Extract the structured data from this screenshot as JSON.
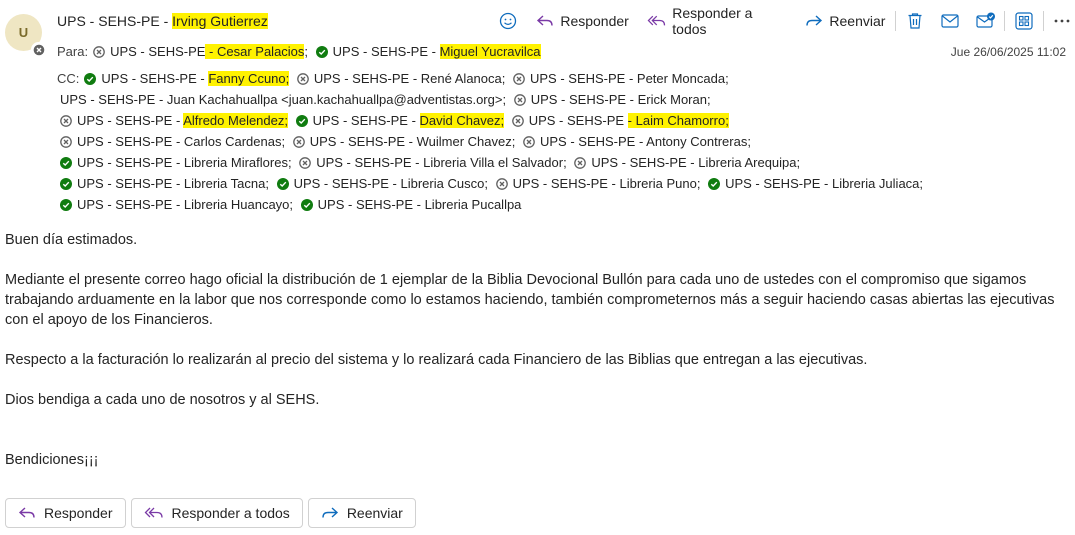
{
  "sender": {
    "avatar_initial": "U",
    "prefix": "UPS - SEHS-PE - ",
    "name": "Irving Gutierrez"
  },
  "toolbar": {
    "reply": "Responder",
    "reply_all": "Responder a todos",
    "forward": "Reenviar"
  },
  "date": "Jue 26/06/2025 11:02",
  "to_label": "Para:",
  "cc_label": "CC:",
  "to": [
    {
      "status": "blocked",
      "pre": "UPS - SEHS-PE",
      "hl": " - Cesar Palacios",
      "post": "",
      "sep": ";"
    },
    {
      "status": "ok",
      "pre": "UPS - SEHS-PE - ",
      "hl": "Miguel Yucravilca  ",
      "post": "",
      "sep": ""
    }
  ],
  "cc_lines": [
    [
      {
        "status": "ok",
        "pre": "UPS - SEHS-PE - ",
        "hl": "Fanny Ccuno;",
        "post": "",
        "sep": ""
      },
      {
        "status": "blocked",
        "pre": "UPS - SEHS-PE - René Alanoca",
        "hl": "",
        "post": "",
        "sep": ";"
      },
      {
        "status": "blocked",
        "pre": "UPS - SEHS-PE - Peter Moncada",
        "hl": "",
        "post": "",
        "sep": ";"
      }
    ],
    [
      {
        "status": "none",
        "pre": "UPS - SEHS-PE - Juan Kachahuallpa <juan.kachahuallpa@adventistas.org>",
        "hl": "",
        "post": "",
        "sep": ";"
      },
      {
        "status": "blocked",
        "pre": "UPS - SEHS-PE - Erick Moran",
        "hl": "",
        "post": "",
        "sep": ";"
      }
    ],
    [
      {
        "status": "blocked",
        "pre": "UPS - SEHS-PE - ",
        "hl": "Alfredo Melendez;",
        "post": "",
        "sep": ""
      },
      {
        "status": "ok",
        "pre": "UPS - SEHS-PE - ",
        "hl": "David Chavez;",
        "post": "",
        "sep": ""
      },
      {
        "status": "blocked",
        "pre": "UPS - SEHS-PE ",
        "hl": "- Laim Chamorro;",
        "post": "",
        "sep": ""
      }
    ],
    [
      {
        "status": "blocked",
        "pre": "UPS - SEHS-PE - Carlos Cardenas",
        "hl": "",
        "post": "",
        "sep": ";"
      },
      {
        "status": "blocked",
        "pre": "UPS - SEHS-PE - Wuilmer Chavez",
        "hl": "",
        "post": "",
        "sep": ";"
      },
      {
        "status": "blocked",
        "pre": "UPS - SEHS-PE - Antony Contreras",
        "hl": "",
        "post": "",
        "sep": ";"
      }
    ],
    [
      {
        "status": "ok",
        "pre": "UPS - SEHS-PE - Libreria Miraflores",
        "hl": "",
        "post": "",
        "sep": ";"
      },
      {
        "status": "blocked",
        "pre": "UPS - SEHS-PE - Libreria Villa el Salvador",
        "hl": "",
        "post": "",
        "sep": ";"
      },
      {
        "status": "blocked",
        "pre": "UPS - SEHS-PE - Libreria Arequipa",
        "hl": "",
        "post": "",
        "sep": ";"
      }
    ],
    [
      {
        "status": "ok",
        "pre": "UPS - SEHS-PE - Libreria Tacna",
        "hl": "",
        "post": "",
        "sep": ";"
      },
      {
        "status": "ok",
        "pre": "UPS - SEHS-PE - Libreria Cusco",
        "hl": "",
        "post": "",
        "sep": ";"
      },
      {
        "status": "blocked",
        "pre": "UPS - SEHS-PE - Libreria Puno",
        "hl": "",
        "post": "",
        "sep": ";"
      },
      {
        "status": "ok",
        "pre": "UPS - SEHS-PE - Libreria Juliaca",
        "hl": "",
        "post": "",
        "sep": ";"
      }
    ],
    [
      {
        "status": "ok",
        "pre": "UPS - SEHS-PE - Libreria Huancayo",
        "hl": "",
        "post": "",
        "sep": ";"
      },
      {
        "status": "ok",
        "pre": "UPS - SEHS-PE - Libreria Pucallpa",
        "hl": "",
        "post": "",
        "sep": ""
      }
    ]
  ],
  "body": {
    "greeting": "Buen día estimados.",
    "p1": "Mediante el presente correo hago oficial la distribución de 1 ejemplar de la Biblia Devocional Bullón para cada uno de ustedes con el compromiso que sigamos trabajando arduamente en la labor que nos corresponde como lo estamos haciendo, también comprometernos más a seguir haciendo casas abiertas las ejecutivas con el apoyo de los Financieros.",
    "p2": "Respecto a la facturación lo realizarán al precio del sistema y lo realizará cada Financiero de las Biblias que entregan a las ejecutivas.",
    "p3": "Dios bendiga a cada uno de nosotros y al SEHS.",
    "closing": "Bendiciones¡¡¡"
  },
  "bottom_buttons": {
    "reply": "Responder",
    "reply_all": "Responder a todos",
    "forward": "Reenviar"
  },
  "colors": {
    "highlight": "#fff200",
    "ok": "#107c10",
    "blocked": "#616161",
    "accent": "#0f6cbd",
    "reply_icon": "#7a3aa6"
  }
}
